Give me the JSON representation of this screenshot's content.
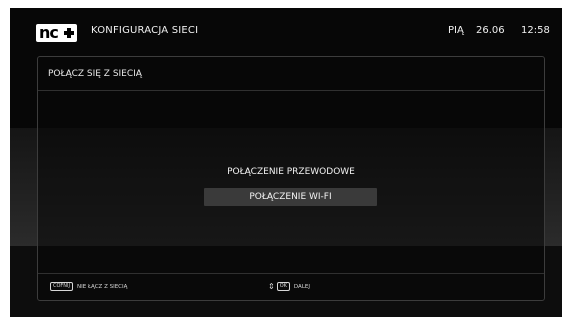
{
  "header": {
    "logo_text": "nc",
    "title": "KONFIGURACJA SIECI",
    "day": "PIĄ",
    "date": "26.06",
    "time": "12:58"
  },
  "panel": {
    "title": "POŁĄCZ SIĘ Z SIECIĄ",
    "options": [
      {
        "label": "POŁĄCZENIE PRZEWODOWE",
        "selected": false
      },
      {
        "label": "POŁĄCZENIE WI-FI",
        "selected": true
      }
    ]
  },
  "footer": {
    "back_key": "COFNIJ",
    "back_label": "NIE ŁĄCZ Z SIECIĄ",
    "ok_key": "OK",
    "ok_label": "DALEJ",
    "updown_glyph": "⇕"
  },
  "icons": {
    "logo": "nc-plus-logo",
    "updown": "up-down-arrows-icon"
  },
  "colors": {
    "background": "#070707",
    "text": "#f0f0f0",
    "highlight": "#3a3a3a"
  }
}
